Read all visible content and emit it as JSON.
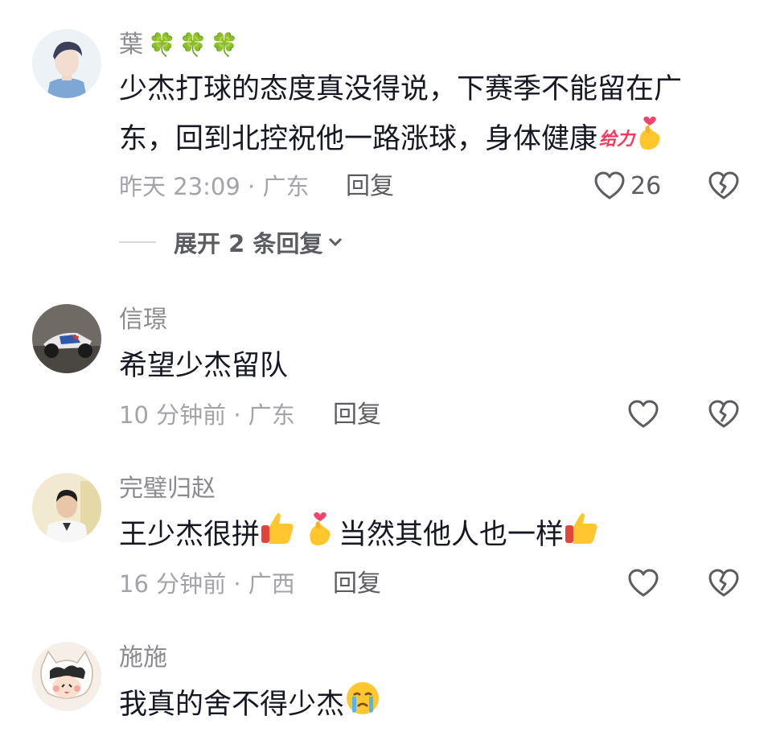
{
  "comments": [
    {
      "username": "葉",
      "username_decor": "🍀🍀🍀",
      "text_line1": "少杰打球的态度真没得说，下赛季不能留在广",
      "text_line2": "东，回到北控祝他一路涨球，身体健康",
      "sticker_text": "给力",
      "time_location": "昨天 23:09 · 广东",
      "reply_label": "回复",
      "like_count": "26",
      "expand_label": "展开 2 条回复"
    },
    {
      "username": "信璟",
      "text": "希望少杰留队",
      "time_location": "10 分钟前 · 广东",
      "reply_label": "回复"
    },
    {
      "username": "完璧归赵",
      "text_a": "王少杰很拼",
      "text_b": "当然其他人也一样",
      "time_location": "16 分钟前 · 广西",
      "reply_label": "回复"
    },
    {
      "username": "施施",
      "text": "我真的舍不得少杰"
    }
  ],
  "icons": {
    "like": "heart-outline-icon",
    "dislike": "broken-heart-icon",
    "expand": "chevron-down-icon"
  },
  "colors": {
    "username": "#8a8b91",
    "meta": "#a3a4aa",
    "text": "#161823"
  }
}
